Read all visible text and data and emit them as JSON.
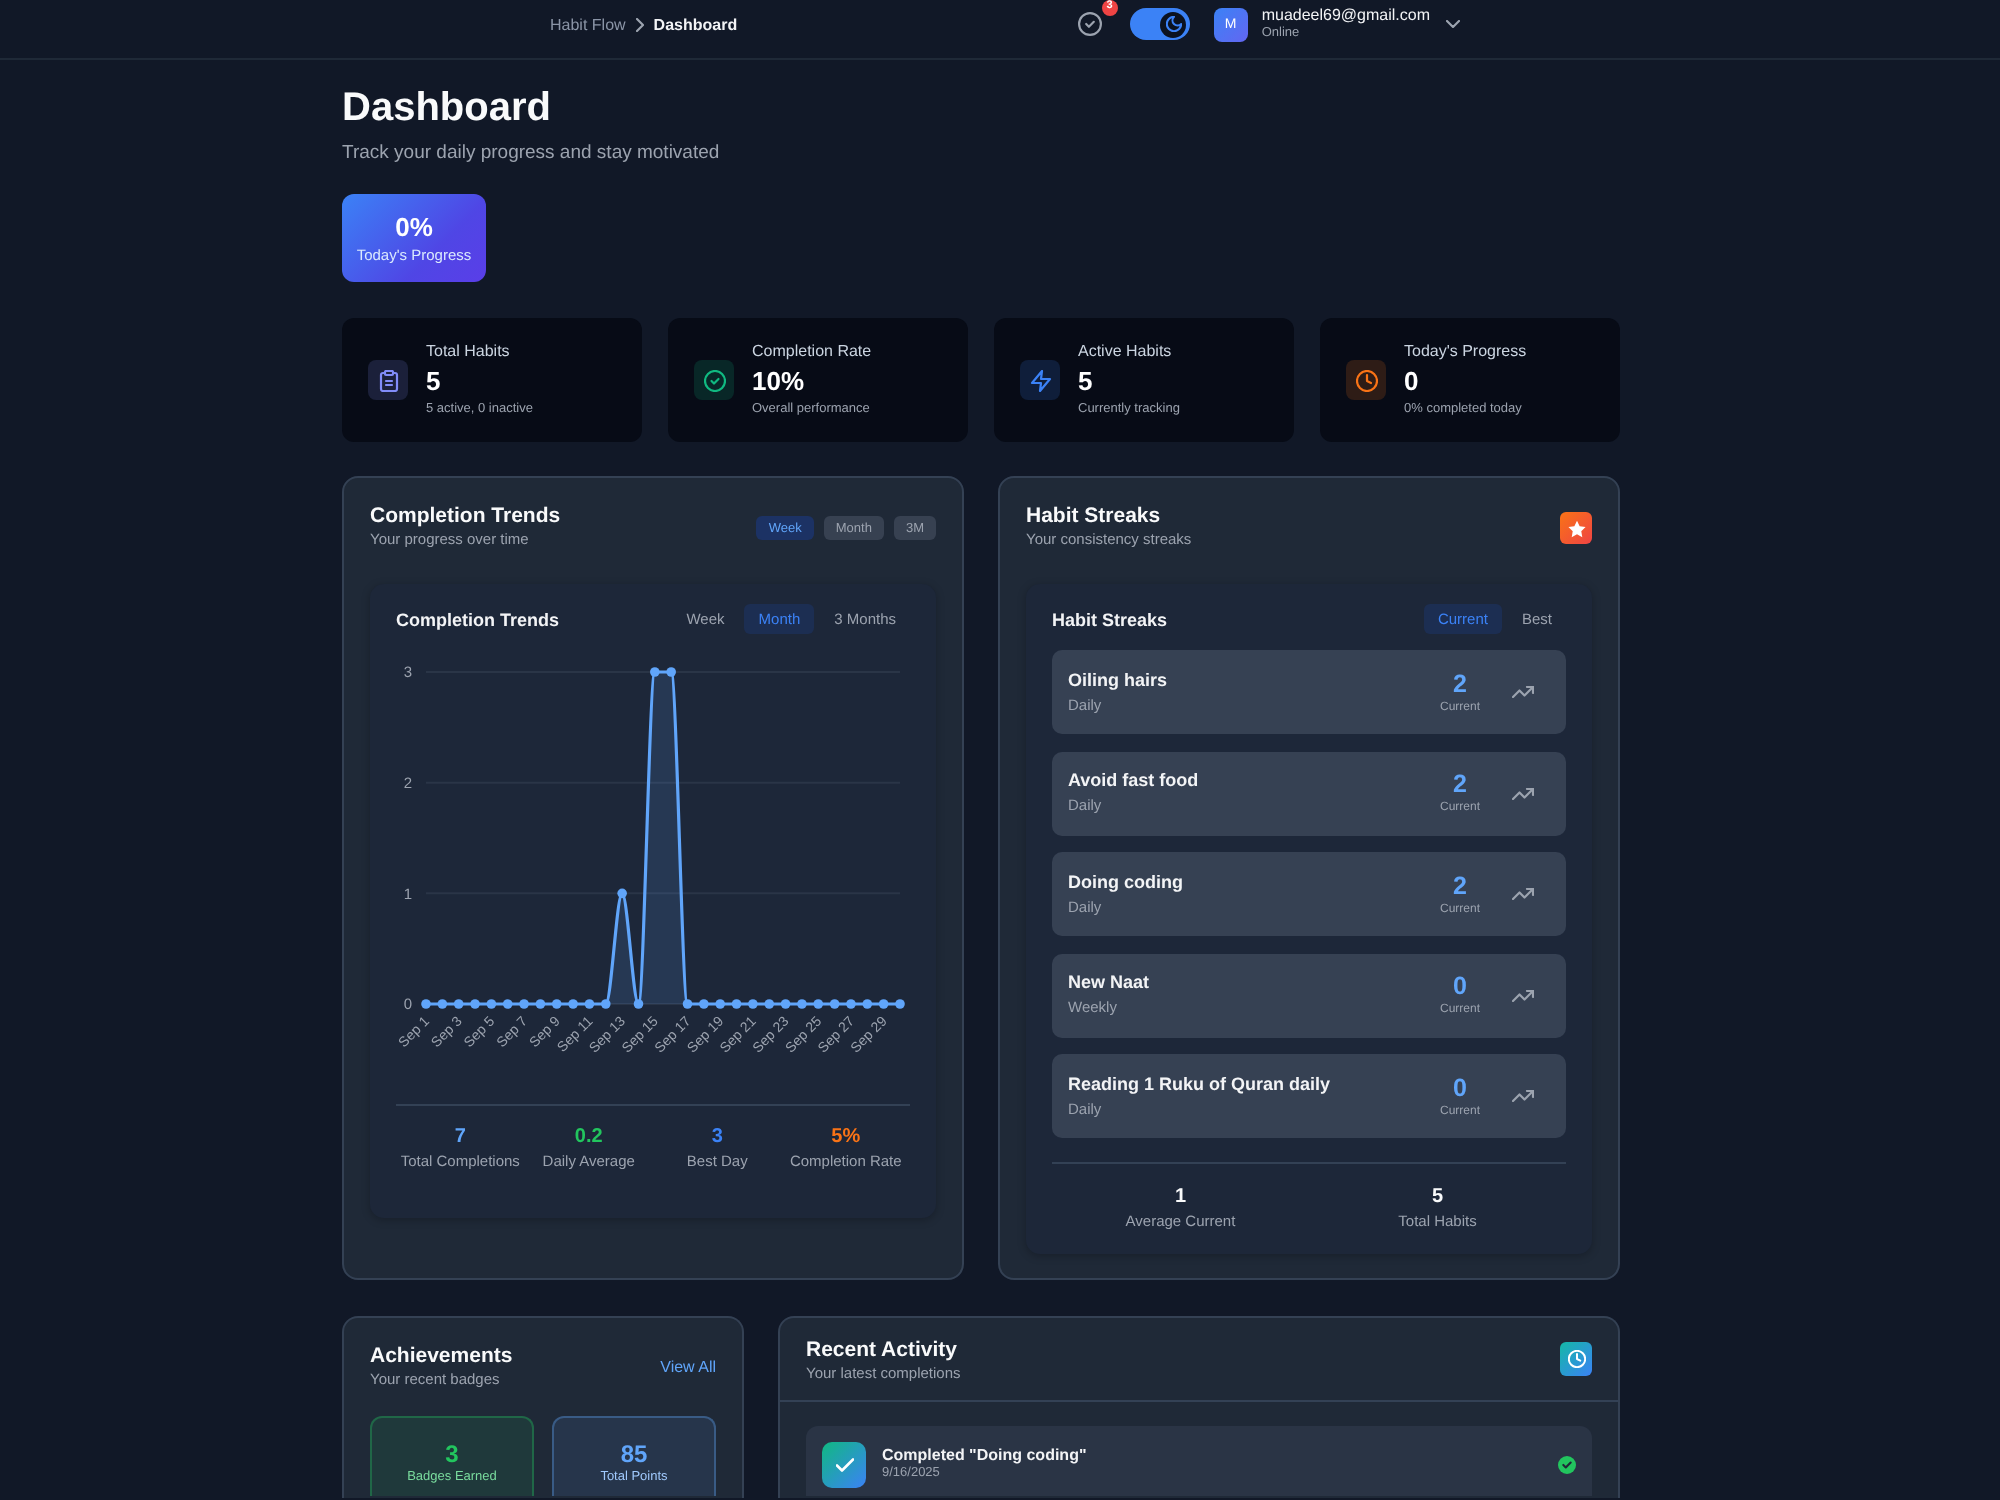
{
  "topbar": {
    "breadcrumb": [
      {
        "label": "Habit Flow",
        "current": false
      },
      {
        "label": "Dashboard",
        "current": true
      }
    ],
    "notifications": {
      "count": "3"
    },
    "dark_mode": {
      "on": true
    },
    "user": {
      "initial": "M",
      "email": "muadeel69@gmail.com",
      "status": "Online"
    }
  },
  "header": {
    "title": "Dashboard",
    "subtitle": "Track your daily progress and stay motivated",
    "progress": {
      "value": "0%",
      "label": "Today's Progress"
    }
  },
  "stats": [
    {
      "label": "Total Habits",
      "value": "5",
      "detail": "5 active, 0 inactive"
    },
    {
      "label": "Completion Rate",
      "value": "10%",
      "detail": "Overall performance"
    },
    {
      "label": "Active Habits",
      "value": "5",
      "detail": "Currently tracking"
    },
    {
      "label": "Today's Progress",
      "value": "0",
      "detail": "0% completed today"
    }
  ],
  "trends": {
    "title": "Completion Trends",
    "subtitle": "Your progress over time",
    "ranges": [
      {
        "label": "Week",
        "selected": true
      },
      {
        "label": "Month",
        "selected": false
      },
      {
        "label": "3M",
        "selected": false
      }
    ],
    "card": {
      "title": "Completion Trends",
      "periods": [
        {
          "label": "Week",
          "selected": false
        },
        {
          "label": "Month",
          "selected": true
        },
        {
          "label": "3 Months",
          "selected": false
        }
      ],
      "chart_data": {
        "type": "area",
        "categories": [
          "Sep 1",
          null,
          "Sep 3",
          null,
          "Sep 5",
          null,
          "Sep 7",
          null,
          "Sep 9",
          null,
          "Sep 11",
          null,
          "Sep 13",
          null,
          "Sep 15",
          null,
          "Sep 17",
          null,
          "Sep 19",
          null,
          "Sep 21",
          null,
          "Sep 23",
          null,
          "Sep 25",
          null,
          "Sep 27",
          null,
          "Sep 29",
          null
        ],
        "ylim": [
          0,
          3
        ],
        "yticks": [
          0,
          1,
          2,
          3
        ],
        "series": [
          {
            "color": "#60a5fa",
            "values": [
              0,
              0,
              0,
              0,
              0,
              0,
              0,
              0,
              0,
              0,
              0,
              0,
              1,
              0,
              3,
              3,
              0,
              0,
              0,
              0,
              0,
              0,
              0,
              0,
              0,
              0,
              0,
              0,
              0,
              0
            ]
          }
        ]
      },
      "summary": [
        {
          "value": "7",
          "label": "Total Completions",
          "color": "#60a5fa"
        },
        {
          "value": "0.2",
          "label": "Daily Average",
          "color": "#22c55e"
        },
        {
          "value": "3",
          "label": "Best Day",
          "color": "#3b82f6"
        },
        {
          "value": "5%",
          "label": "Completion Rate",
          "color": "#f97316"
        }
      ]
    }
  },
  "streaks": {
    "title": "Habit Streaks",
    "subtitle": "Your consistency streaks",
    "card": {
      "title": "Habit Streaks",
      "modes": [
        {
          "label": "Current",
          "selected": true
        },
        {
          "label": "Best",
          "selected": false
        }
      ],
      "habits": [
        {
          "name": "Oiling hairs",
          "frequency": "Daily",
          "count": "2",
          "count_label": "Current"
        },
        {
          "name": "Avoid fast food",
          "frequency": "Daily",
          "count": "2",
          "count_label": "Current"
        },
        {
          "name": "Doing coding",
          "frequency": "Daily",
          "count": "2",
          "count_label": "Current"
        },
        {
          "name": "New Naat",
          "frequency": "Weekly",
          "count": "0",
          "count_label": "Current"
        },
        {
          "name": "Reading 1 Ruku of Quran daily",
          "frequency": "Daily",
          "count": "0",
          "count_label": "Current"
        }
      ],
      "summary": [
        {
          "value": "1",
          "label": "Average Current"
        },
        {
          "value": "5",
          "label": "Total Habits"
        }
      ]
    }
  },
  "achievements": {
    "title": "Achievements",
    "subtitle": "Your recent badges",
    "link": "View All",
    "tiles": [
      {
        "value": "3",
        "label": "Badges Earned",
        "color": "#22c55e"
      },
      {
        "value": "85",
        "label": "Total Points",
        "color": "#60a5fa"
      }
    ]
  },
  "activity": {
    "title": "Recent Activity",
    "subtitle": "Your latest completions",
    "items": [
      {
        "text": "Completed \"Doing coding\"",
        "date": "9/16/2025",
        "completed": true
      }
    ]
  }
}
